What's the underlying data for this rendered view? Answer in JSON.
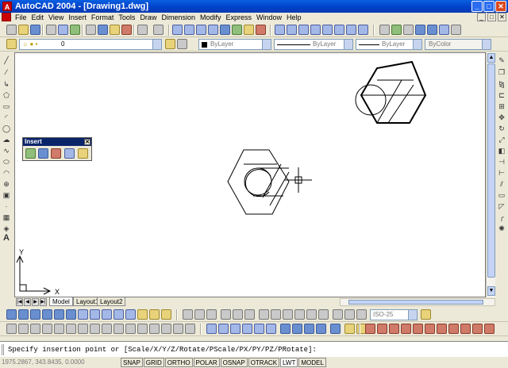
{
  "window": {
    "title": "AutoCAD 2004 - [Drawing1.dwg]",
    "app_icon": "autocad-icon",
    "buttons": [
      "minimize",
      "maximize",
      "close"
    ]
  },
  "menu": {
    "items": [
      "File",
      "Edit",
      "View",
      "Insert",
      "Format",
      "Tools",
      "Draw",
      "Dimension",
      "Modify",
      "Express",
      "Window",
      "Help"
    ]
  },
  "properties": {
    "layer": "0",
    "color": "ByLayer",
    "linetype": "ByLayer",
    "lineweight": "ByLayer",
    "plotstyle": "ByColor"
  },
  "insert_panel": {
    "title": "Insert",
    "close_label": "✕"
  },
  "canvas": {
    "ucs_y_label": "Y",
    "ucs_x_label": "X"
  },
  "tabs": {
    "items": [
      "Model",
      "Layout1",
      "Layout2"
    ],
    "active": "Model"
  },
  "dim_style": {
    "value": "ISO-25"
  },
  "command_line": {
    "prompt": "Specify insertion point or [Scale/X/Y/Z/Rotate/PScale/PX/PY/PZ/PRotate]:"
  },
  "status_bar": {
    "coordinates": "1975.2867, 343.8435, 0.0000",
    "toggles": [
      "SNAP",
      "GRID",
      "ORTHO",
      "POLAR",
      "OSNAP",
      "OTRACK",
      "LWT",
      "MODEL"
    ]
  },
  "colors": {
    "title_bar": "#0040c8",
    "canvas_background": "#ffffff",
    "drawing_lines": "#000000"
  }
}
